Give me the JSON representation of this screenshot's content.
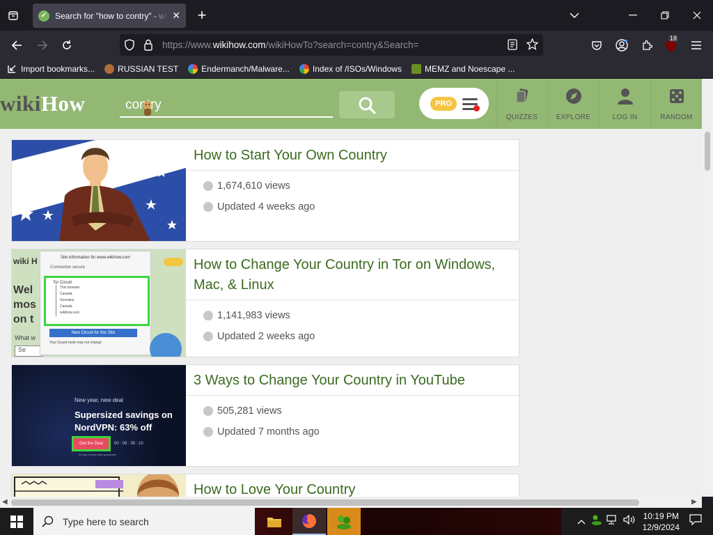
{
  "browser": {
    "tab": {
      "title": "Search for \"how to contry\" - wikiHow",
      "close": "✕"
    },
    "new_tab": "+",
    "url": {
      "prefix": "https://www.",
      "domain": "wikihow.com",
      "path": "/wikiHowTo?search=contry&Search="
    },
    "notification_count": "18"
  },
  "bookmarks": [
    {
      "label": "Import bookmarks...",
      "color": "#fbfbfe"
    },
    {
      "label": "RUSSIAN TEST",
      "color": "#b06a3b"
    },
    {
      "label": "Endermanch/Malware...",
      "color": "#4285f4"
    },
    {
      "label": "Index of /ISOs/Windows",
      "color": "#4285f4"
    },
    {
      "label": "MEMZ and Noescape ...",
      "color": "#6b8e23"
    }
  ],
  "wikihow": {
    "logo_wiki": "wiki",
    "logo_how": "How",
    "search_value": "contry",
    "pro_label": "PRO",
    "nav": [
      {
        "label": "QUIZZES",
        "icon": "quiz-icon"
      },
      {
        "label": "EXPLORE",
        "icon": "compass-icon"
      },
      {
        "label": "LOG IN",
        "icon": "user-icon"
      },
      {
        "label": "RANDOM",
        "icon": "dice-icon"
      }
    ],
    "results": [
      {
        "title": "How to Start Your Own Country",
        "views": "1,674,610 views",
        "updated": "Updated 4 weeks ago"
      },
      {
        "title": "How to Change Your Country in Tor on Windows, Mac, & Linux",
        "views": "1,141,983 views",
        "updated": "Updated 2 weeks ago"
      },
      {
        "title": "3 Ways to Change Your Country in YouTube",
        "views": "505,281 views",
        "updated": "Updated 7 months ago"
      },
      {
        "title": "How to Love Your Country"
      }
    ],
    "thumb2": {
      "logo": "wiki H",
      "popup_title": "Site information for www.wikihow.com",
      "conn": "Connection secure",
      "circuit_title": "Tor Circuit",
      "nodes": [
        "This browser",
        "Canada",
        "Germany",
        "Canada",
        "wikihow.com"
      ],
      "new_circuit": "New Circuit for this Site",
      "guard": "Your Guard node may not change",
      "bg_text": "Wel mos on t",
      "what": "What w",
      "search": "Se"
    },
    "thumb3": {
      "line1": "New year, new deal",
      "line2": "Supersized savings on",
      "line3": "NordVPN: 63% off",
      "cta": "Get the Deal",
      "timer": "00 : 09 : 39 : 10",
      "footnote": "30-day money-back guarantee"
    }
  },
  "taskbar": {
    "search_placeholder": "Type here to search",
    "time": "10:19 PM",
    "date": "12/9/2024"
  }
}
